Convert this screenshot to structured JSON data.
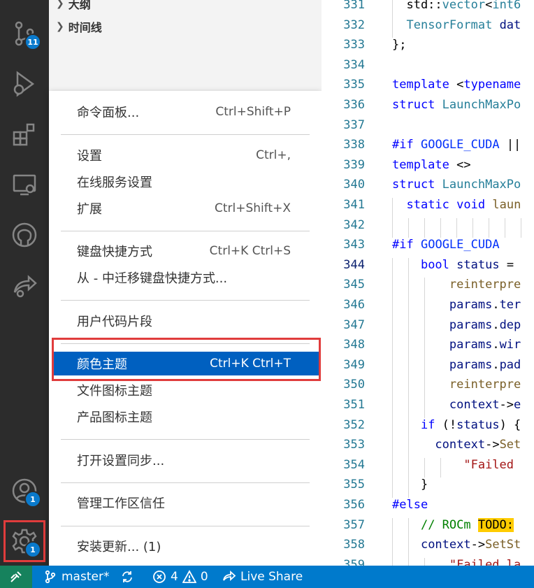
{
  "sidebar": {
    "outline_label": "大纲",
    "timeline_label": "时间线"
  },
  "activity": {
    "scm_badge": "11",
    "accounts_badge": "1",
    "manage_badge": "1"
  },
  "menu": {
    "command_palette": {
      "label": "命令面板...",
      "shortcut": "Ctrl+Shift+P"
    },
    "settings": {
      "label": "设置",
      "shortcut": "Ctrl+,"
    },
    "online_services": {
      "label": "在线服务设置"
    },
    "extensions": {
      "label": "扩展",
      "shortcut": "Ctrl+Shift+X"
    },
    "keyboard_shortcuts": {
      "label": "键盘快捷方式",
      "shortcut": "Ctrl+K Ctrl+S"
    },
    "migrate_keymaps": {
      "label": "从 - 中迁移键盘快捷方式..."
    },
    "user_snippets": {
      "label": "用户代码片段"
    },
    "color_theme": {
      "label": "颜色主题",
      "shortcut": "Ctrl+K Ctrl+T"
    },
    "file_icon_theme": {
      "label": "文件图标主题"
    },
    "product_icon_theme": {
      "label": "产品图标主题"
    },
    "settings_sync": {
      "label": "打开设置同步..."
    },
    "workspace_trust": {
      "label": "管理工作区信任"
    },
    "install_update": {
      "label": "安装更新... (1)"
    }
  },
  "editor": {
    "current_line": "344",
    "lines": [
      {
        "n": "331",
        "code": "  std::vector<int6"
      },
      {
        "n": "332",
        "code": "  TensorFormat dat"
      },
      {
        "n": "333",
        "code": "};"
      },
      {
        "n": "334",
        "code": ""
      },
      {
        "n": "335",
        "code": "template <typename"
      },
      {
        "n": "336",
        "code": "struct LaunchMaxPo"
      },
      {
        "n": "337",
        "code": ""
      },
      {
        "n": "338",
        "code": "#if GOOGLE_CUDA ||"
      },
      {
        "n": "339",
        "code": "template <>"
      },
      {
        "n": "340",
        "code": "struct LaunchMaxPo"
      },
      {
        "n": "341",
        "code": "  static void laun"
      },
      {
        "n": "342",
        "code": ""
      },
      {
        "n": "343",
        "code": "#if GOOGLE_CUDA"
      },
      {
        "n": "344",
        "code": "    bool status ="
      },
      {
        "n": "345",
        "code": "        reinterpre"
      },
      {
        "n": "346",
        "code": "        params.ter"
      },
      {
        "n": "347",
        "code": "        params.dep"
      },
      {
        "n": "348",
        "code": "        params.wir"
      },
      {
        "n": "349",
        "code": "        params.pad"
      },
      {
        "n": "350",
        "code": "        reinterpre"
      },
      {
        "n": "351",
        "code": "        context->e"
      },
      {
        "n": "352",
        "code": "    if (!status) {"
      },
      {
        "n": "353",
        "code": "      context->Set"
      },
      {
        "n": "354",
        "code": "          \"Failed"
      },
      {
        "n": "355",
        "code": "    }"
      },
      {
        "n": "356",
        "code": "#else"
      },
      {
        "n": "357",
        "code": "    // ROCm TODO:"
      },
      {
        "n": "358",
        "code": "    context->SetSt"
      },
      {
        "n": "359",
        "code": "        \"Failed la"
      }
    ]
  },
  "statusbar": {
    "branch": "master*",
    "errors": "4",
    "warnings": "0",
    "live_share": "Live Share"
  }
}
